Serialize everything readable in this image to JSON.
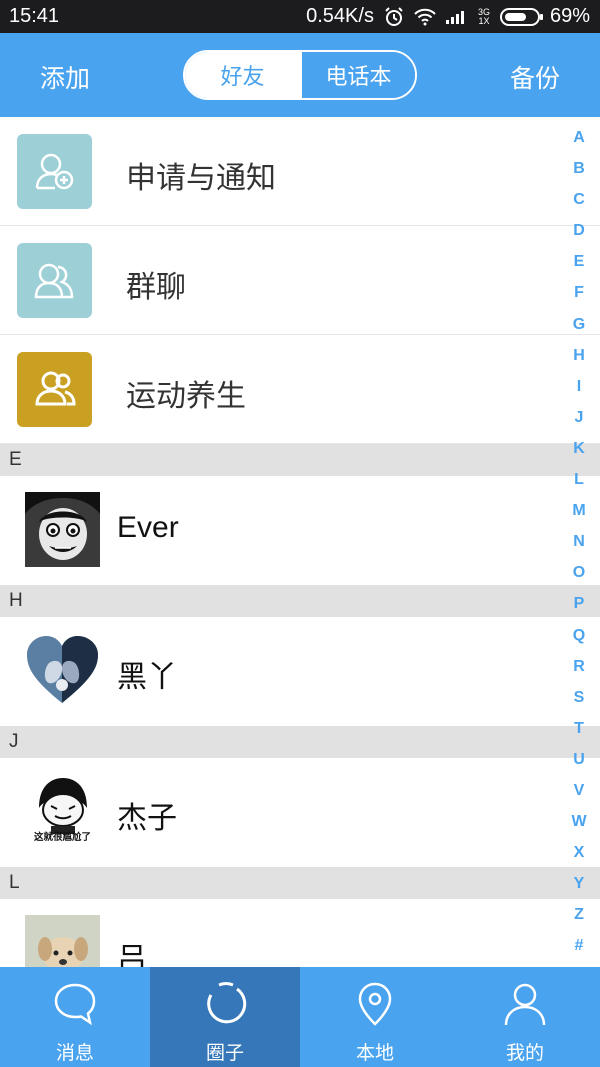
{
  "status_bar": {
    "time": "15:41",
    "network_speed": "0.54K/s",
    "network_type": "3G",
    "network_sub": "1X",
    "battery": "69%",
    "battery_level": 0.69
  },
  "top_bar": {
    "left_button": "添加",
    "right_button": "备份",
    "tabs": [
      {
        "label": "好友",
        "active": true
      },
      {
        "label": "电话本",
        "active": false
      }
    ]
  },
  "entries": [
    {
      "label": "申请与通知",
      "icon": "add-person-icon",
      "color": "#9dcfd6"
    },
    {
      "label": "群聊",
      "icon": "group-chat-icon",
      "color": "#9dcfd6"
    },
    {
      "label": "运动养生",
      "icon": "group-people-icon",
      "color": "#c9a022"
    }
  ],
  "sections": [
    {
      "letter": "E",
      "contacts": [
        {
          "name": "Ever",
          "avatar": "manga-face-avatar"
        }
      ]
    },
    {
      "letter": "H",
      "contacts": [
        {
          "name": "黑丫",
          "avatar": "heart-avatar"
        }
      ]
    },
    {
      "letter": "J",
      "contacts": [
        {
          "name": "杰子",
          "avatar": "meme-avatar",
          "avatar_caption": "这就很尴尬了"
        }
      ]
    },
    {
      "letter": "L",
      "contacts": [
        {
          "name": "吕",
          "avatar": "puppy-avatar"
        }
      ]
    }
  ],
  "index_letters": [
    "A",
    "B",
    "C",
    "D",
    "E",
    "F",
    "G",
    "H",
    "I",
    "J",
    "K",
    "L",
    "M",
    "N",
    "O",
    "P",
    "Q",
    "R",
    "S",
    "T",
    "U",
    "V",
    "W",
    "X",
    "Y",
    "Z",
    "#"
  ],
  "bottom_nav": [
    {
      "label": "消息",
      "icon": "chat-bubble-icon",
      "active": false
    },
    {
      "label": "圈子",
      "icon": "circle-icon",
      "active": true
    },
    {
      "label": "本地",
      "icon": "location-pin-icon",
      "active": false
    },
    {
      "label": "我的",
      "icon": "person-icon",
      "active": false
    }
  ],
  "colors": {
    "accent": "#4aa3ee",
    "nav_active": "#3577b8",
    "section_bg": "#e1e1e1"
  }
}
